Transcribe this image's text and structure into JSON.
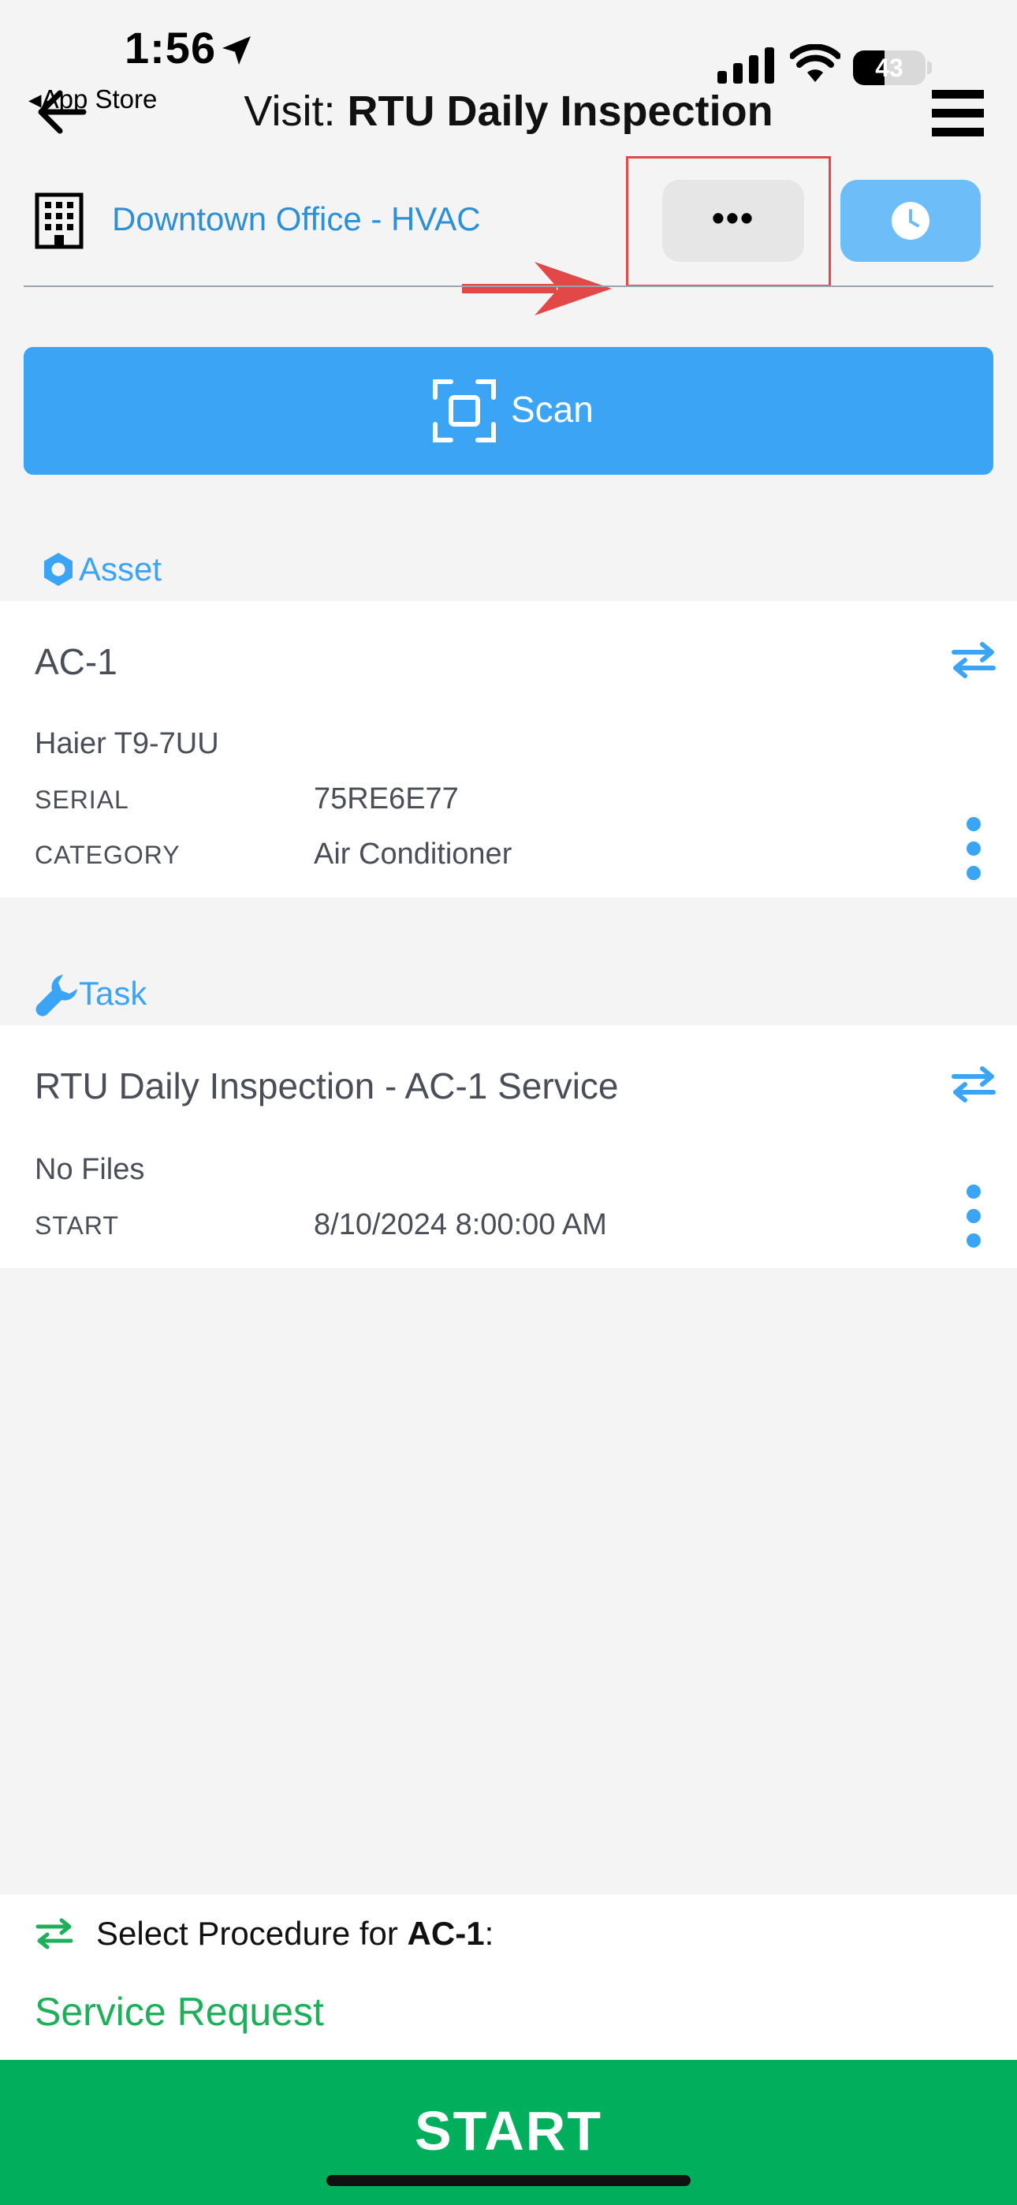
{
  "status_bar": {
    "time": "1:56",
    "back_app": "App Store",
    "battery": "43",
    "battery_percent": 43
  },
  "header": {
    "title_prefix": "Visit:",
    "title_main": "RTU Daily Inspection"
  },
  "location": {
    "site": "Downtown Office - HVAC",
    "more_label": "•••"
  },
  "scan": {
    "label": "Scan"
  },
  "asset": {
    "section_label": "Asset",
    "name": "AC-1",
    "model": "Haier T9-7UU",
    "serial_key": "SERIAL",
    "serial_value": "75RE6E77",
    "category_key": "CATEGORY",
    "category_value": "Air Conditioner"
  },
  "task": {
    "section_label": "Task",
    "name": "RTU Daily Inspection - AC-1 Service",
    "files": "No Files",
    "start_key": "START",
    "start_value": "8/10/2024 8:00:00 AM"
  },
  "procedure": {
    "label_prefix": "Select Procedure for",
    "asset": "AC-1",
    "label_suffix": ":",
    "value": "Service Request"
  },
  "start_button": {
    "label": "START"
  },
  "colors": {
    "accent_blue": "#3ba4f5",
    "link_blue": "#2d8fd5",
    "green": "#00ae5b",
    "highlight_red": "#e34848"
  }
}
